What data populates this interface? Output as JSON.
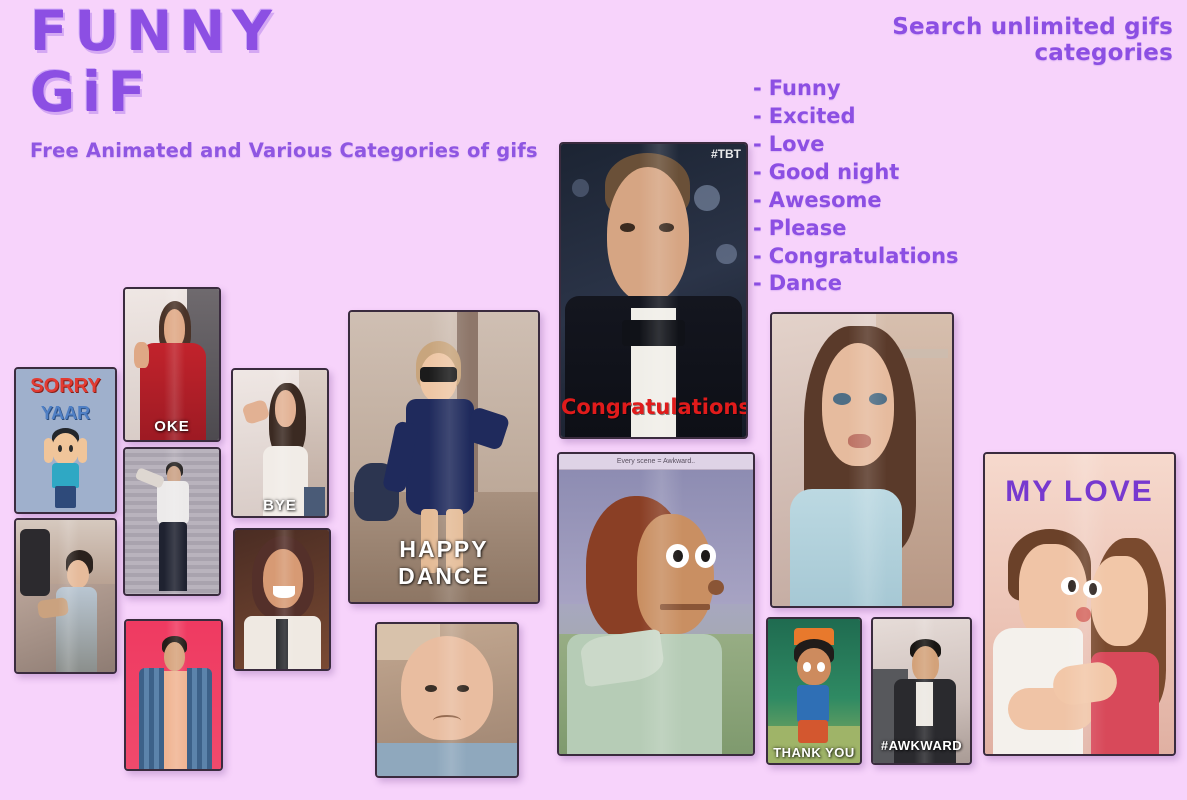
{
  "app": {
    "logo_line1": "FUNNY",
    "logo_line2": "GiF",
    "tagline": "Free Animated and Various Categories of  gifs",
    "brand_color": "#8c4fe3",
    "background_color": "#f7d3fb"
  },
  "categories": {
    "title": "Search unlimited gifs categories",
    "dash": "-",
    "items": [
      {
        "label": "Funny"
      },
      {
        "label": "Excited"
      },
      {
        "label": "Love"
      },
      {
        "label": "Good night"
      },
      {
        "label": "Awesome"
      },
      {
        "label": "Please"
      },
      {
        "label": "Congratulations"
      },
      {
        "label": "Dance"
      }
    ]
  },
  "gallery": {
    "tiles": [
      {
        "id": "sorry-yaar",
        "caption": "",
        "word1": "SORRY",
        "word2": "YAAR"
      },
      {
        "id": "red-top-woman",
        "caption": "OKE"
      },
      {
        "id": "bye-woman",
        "caption": "BYE"
      },
      {
        "id": "dancing-man",
        "caption": ""
      },
      {
        "id": "toddler-hug",
        "caption": ""
      },
      {
        "id": "smiling-woman",
        "caption": ""
      },
      {
        "id": "plaid-shirt-man",
        "caption": ""
      },
      {
        "id": "happy-dance-kid",
        "caption": "HAPPY DANCE"
      },
      {
        "id": "sad-baby",
        "caption": ""
      },
      {
        "id": "congratulations",
        "caption": "Congratulations!",
        "watermark": "#TBT"
      },
      {
        "id": "awkward-puppet",
        "caption": "",
        "topbar": "Every scene = Awkward.."
      },
      {
        "id": "blue-top-woman",
        "caption": ""
      },
      {
        "id": "thank-you-boy",
        "caption": "THANK YOU"
      },
      {
        "id": "awkward-kid",
        "caption": "#AWKWARD"
      },
      {
        "id": "my-love",
        "caption": "",
        "title": "MY LOVE"
      }
    ]
  }
}
